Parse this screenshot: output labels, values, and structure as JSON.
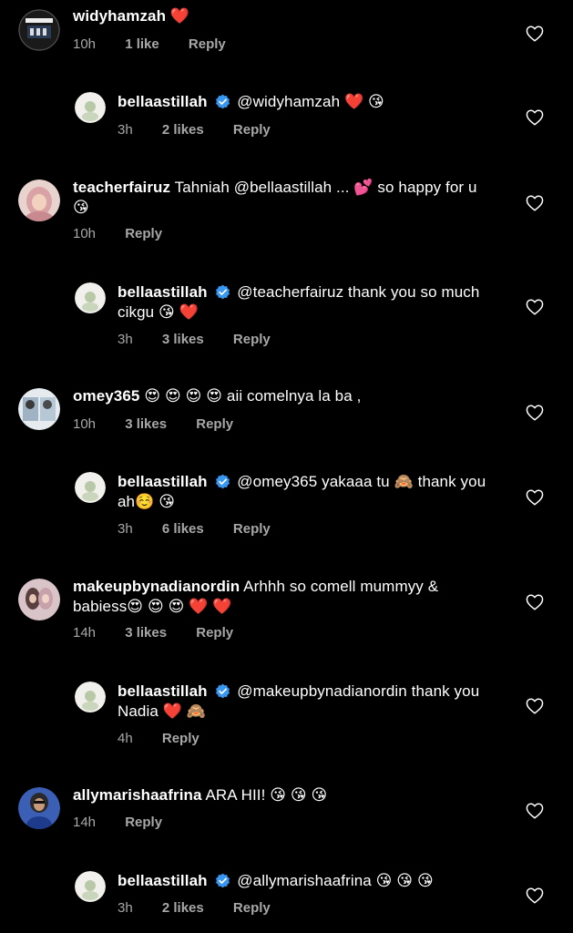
{
  "comments": [
    {
      "username": "widyhamzah",
      "text": "❤️",
      "time": "10h",
      "likes": "1 like",
      "reply_label": "Reply"
    },
    {
      "username": "bellaastillah",
      "verified": true,
      "text": "@widyhamzah ❤️ 😘",
      "time": "3h",
      "likes": "2 likes",
      "reply_label": "Reply"
    },
    {
      "username": "teacherfairuz",
      "text": "Tahniah @bellaastillah ... 💕 so happy for u 😘",
      "time": "10h",
      "likes": "",
      "reply_label": "Reply"
    },
    {
      "username": "bellaastillah",
      "verified": true,
      "text": "@teacherfairuz thank you so much cikgu 😘 ❤️",
      "time": "3h",
      "likes": "3 likes",
      "reply_label": "Reply"
    },
    {
      "username": "omey365",
      "text": "😍 😍 😍 😍 aii comelnya la ba ,",
      "time": "10h",
      "likes": "3 likes",
      "reply_label": "Reply"
    },
    {
      "username": "bellaastillah",
      "verified": true,
      "text": "@omey365 yakaaa tu 🙈 thank you ah☺️ 😘",
      "time": "3h",
      "likes": "6 likes",
      "reply_label": "Reply"
    },
    {
      "username": "makeupbynadianordin",
      "text": "Arhhh so comell mummyy & babiess😍 😍 😍 ❤️ ❤️",
      "time": "14h",
      "likes": "3 likes",
      "reply_label": "Reply"
    },
    {
      "username": "bellaastillah",
      "verified": true,
      "text": "@makeupbynadianordin thank you Nadia ❤️ 🙈",
      "time": "4h",
      "likes": "",
      "reply_label": "Reply"
    },
    {
      "username": "allymarishaafrina",
      "text": "ARA HII! 😘 😘 😘",
      "time": "14h",
      "likes": "",
      "reply_label": "Reply"
    },
    {
      "username": "bellaastillah",
      "verified": true,
      "text": "@allymarishaafrina 😘 😘 😘",
      "time": "3h",
      "likes": "2 likes",
      "reply_label": "Reply"
    }
  ],
  "icons": {
    "like": "heart-outline-icon",
    "verified": "verified-badge-icon"
  },
  "colors": {
    "background": "#000000",
    "text": "#ffffff",
    "meta": "#a8a8a8",
    "verified": "#3897f0"
  }
}
